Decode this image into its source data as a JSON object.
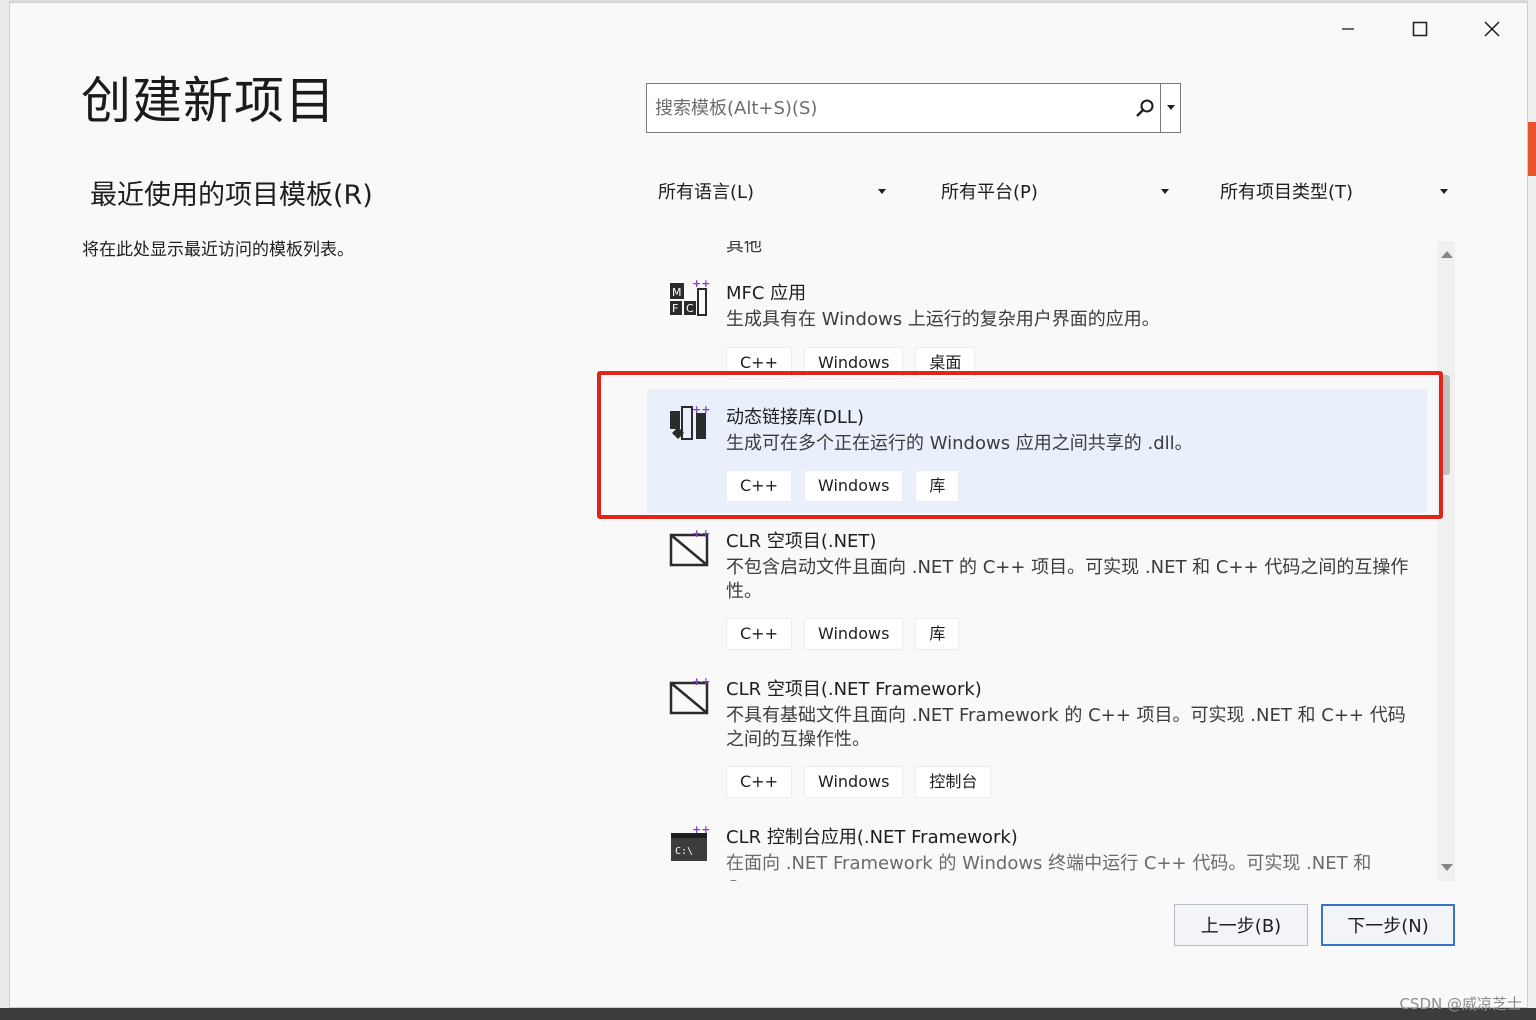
{
  "window": {
    "minimize_label": "minimize",
    "maximize_label": "maximize",
    "close_label": "close"
  },
  "title": "创建新项目",
  "recent": {
    "heading": "最近使用的项目模板(R)",
    "empty_text": "将在此处显示最近访问的模板列表。"
  },
  "search": {
    "placeholder": "搜索模板(Alt+S)(S)"
  },
  "filters": [
    {
      "label": "所有语言(L)"
    },
    {
      "label": "所有平台(P)"
    },
    {
      "label": "所有项目类型(T)"
    }
  ],
  "templates": [
    {
      "name": "MFC 应用",
      "icon": "mfc-icon",
      "desc": "生成具有在 Windows 上运行的复杂用户界面的应用。",
      "tags": [
        "C++",
        "Windows",
        "桌面"
      ],
      "selected": false
    },
    {
      "name": "动态链接库(DLL)",
      "icon": "dll-icon",
      "desc": "生成可在多个正在运行的 Windows 应用之间共享的 .dll。",
      "tags": [
        "C++",
        "Windows",
        "库"
      ],
      "selected": true
    },
    {
      "name": "CLR 空项目(.NET)",
      "icon": "clr-project-icon",
      "desc": "不包含启动文件且面向 .NET 的 C++ 项目。可实现 .NET 和 C++ 代码之间的互操作性。",
      "tags": [
        "C++",
        "Windows",
        "库"
      ],
      "selected": false
    },
    {
      "name": "CLR 空项目(.NET Framework)",
      "icon": "clr-project-icon",
      "desc": "不具有基础文件且面向 .NET Framework 的 C++ 项目。可实现 .NET 和 C++ 代码之间的互操作性。",
      "tags": [
        "C++",
        "Windows",
        "控制台"
      ],
      "selected": false
    },
    {
      "name": "CLR 控制台应用(.NET Framework)",
      "icon": "console-icon",
      "desc": "在面向 .NET Framework 的 Windows 终端中运行 C++ 代码。可实现 .NET 和 C++",
      "tags": [],
      "selected": false
    }
  ],
  "cut_off_text": "其他",
  "buttons": {
    "back": "上一步(B)",
    "next": "下一步(N)"
  },
  "watermark": "CSDN @威凉芝士",
  "colors": {
    "highlight": "#e1251b",
    "selected_bg": "#e9effb",
    "primary_border": "#3773c8"
  }
}
